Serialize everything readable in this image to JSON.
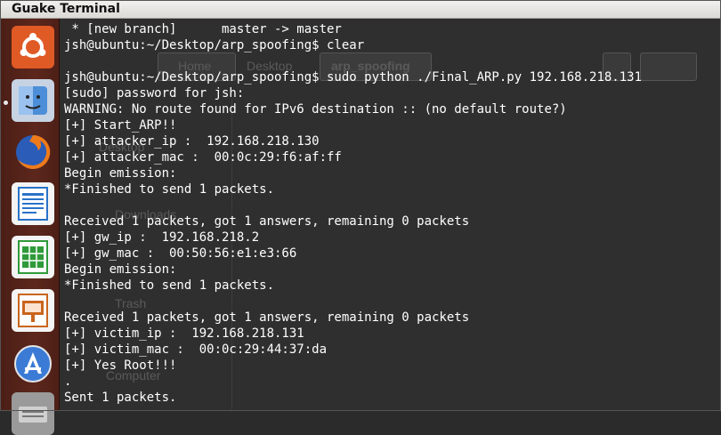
{
  "window": {
    "title": "Guake Terminal"
  },
  "background_window": {
    "breadcrumbs": [
      "Home",
      "Desktop",
      "arp_spoofing"
    ],
    "sidebar_items": [
      "Desktop",
      "Downloads",
      "Trash",
      "Computer"
    ]
  },
  "launcher": {
    "apps": [
      {
        "icon": "ubuntu-dash-icon",
        "color": "#e95420"
      },
      {
        "icon": "files-icon",
        "color": "#4d8ed8"
      },
      {
        "icon": "firefox-icon",
        "color": "#e66000"
      },
      {
        "icon": "libreoffice-writer-icon",
        "color": "#2a72c8"
      },
      {
        "icon": "libreoffice-calc-icon",
        "color": "#2f9a3a"
      },
      {
        "icon": "libreoffice-impress-icon",
        "color": "#c9651d"
      },
      {
        "icon": "software-center-icon",
        "color": "#3b7bd6"
      },
      {
        "icon": "system-settings-icon",
        "color": "#8a8a8a"
      }
    ]
  },
  "terminal": {
    "lines": [
      " * [new branch]      master -> master",
      "jsh@ubuntu:~/Desktop/arp_spoofing$ clear",
      "",
      "jsh@ubuntu:~/Desktop/arp_spoofing$ sudo python ./Final_ARP.py 192.168.218.131",
      "[sudo] password for jsh:",
      "WARNING: No route found for IPv6 destination :: (no default route?)",
      "[+] Start_ARP!!",
      "[+] attacker_ip :  192.168.218.130",
      "[+] attacker_mac :  00:0c:29:f6:af:ff",
      "Begin emission:",
      "*Finished to send 1 packets.",
      "",
      "Received 1 packets, got 1 answers, remaining 0 packets",
      "[+] gw_ip :  192.168.218.2",
      "[+] gw_mac :  00:50:56:e1:e3:66",
      "Begin emission:",
      "*Finished to send 1 packets.",
      "",
      "Received 1 packets, got 1 answers, remaining 0 packets",
      "[+] victim_ip :  192.168.218.131",
      "[+] victim_mac :  00:0c:29:44:37:da",
      "[+] Yes Root!!!",
      ".",
      "Sent 1 packets."
    ]
  }
}
